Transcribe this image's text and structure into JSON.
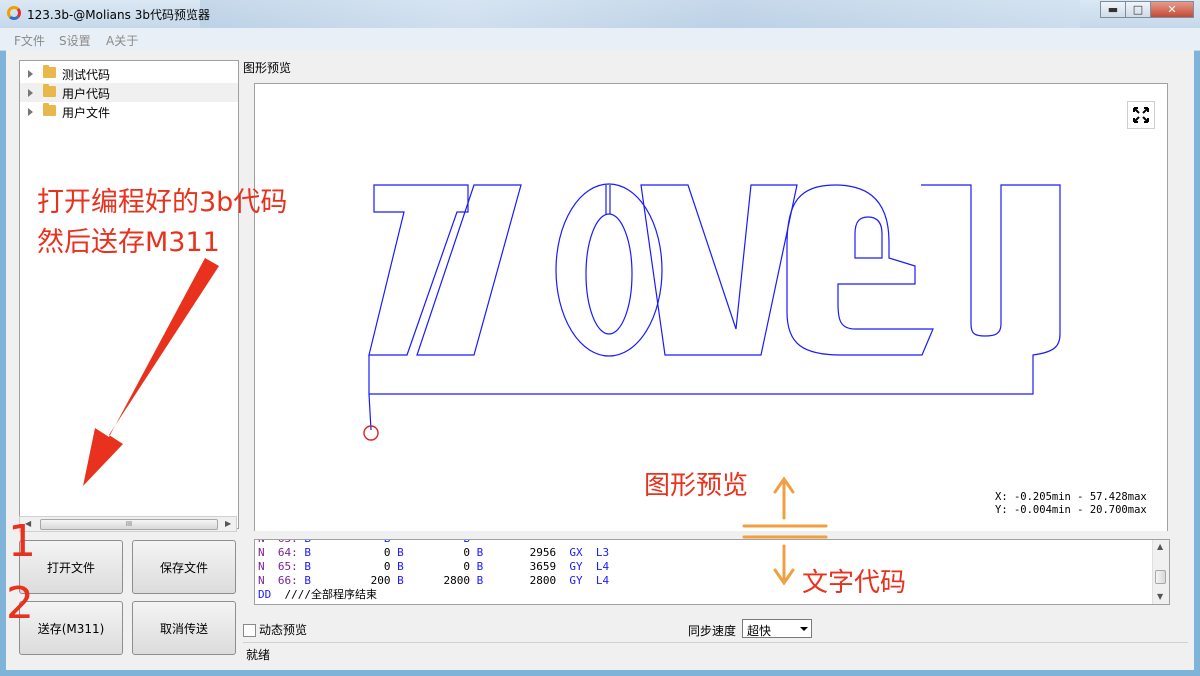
{
  "window": {
    "title": "123.3b-@Molians 3b代码预览器",
    "minimize": "▬",
    "maximize": "□",
    "close": "✕"
  },
  "menu": [
    "F文件",
    "S设置",
    "A关于"
  ],
  "tree": [
    "测试代码",
    "用户代码",
    "用户文件"
  ],
  "scroll_grip": "III",
  "buttons": {
    "open": "打开文件",
    "save": "保存文件",
    "send": "送存(M311)",
    "cancel": "取消传送"
  },
  "preview": {
    "label": "图形预览",
    "coord_x": "X: -0.205min - 57.428max",
    "coord_y": "Y: -0.004min - 20.700max"
  },
  "code_lines": [
    {
      "n": "N",
      "num": "64:",
      "b1": "B",
      "v1": "0",
      "b2": "B",
      "v2": "0",
      "b3": "B",
      "v3": "2956",
      "g": "GX",
      "l": "L3"
    },
    {
      "n": "N",
      "num": "65:",
      "b1": "B",
      "v1": "0",
      "b2": "B",
      "v2": "0",
      "b3": "B",
      "v3": "3659",
      "g": "GY",
      "l": "L4"
    },
    {
      "n": "N",
      "num": "66:",
      "b1": "B",
      "v1": "200",
      "b2": "B",
      "v2": "2800",
      "b3": "B",
      "v3": "2800",
      "g": "GY",
      "l": "L4"
    }
  ],
  "code_end": {
    "dd": "DD",
    "comment": "////全部程序结束"
  },
  "options": {
    "dynamic_preview": "动态预览",
    "sync_speed_label": "同步速度",
    "sync_speed_value": "超快"
  },
  "status": "就绪",
  "annotations": {
    "line1": "打开编程好的3b代码",
    "line2": "然后送存M311",
    "step1": "1",
    "step2": "2",
    "preview_hint": "图形预览",
    "code_hint": "文字代码"
  },
  "colors": {
    "path": "#1a1aff",
    "annotation_red": "#e8321e",
    "annotation_orange": "#f0a040"
  }
}
